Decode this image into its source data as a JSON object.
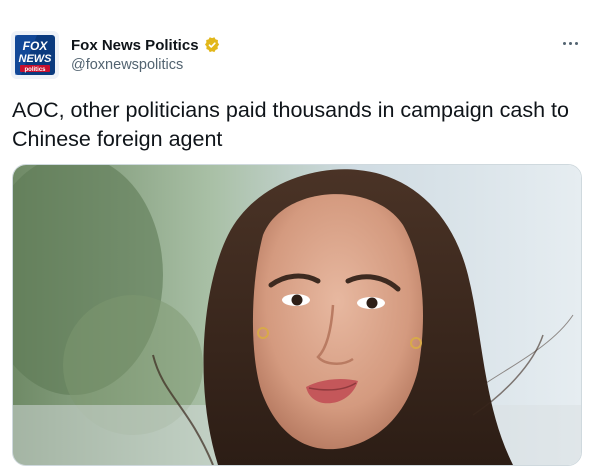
{
  "account": {
    "display_name": "Fox News Politics",
    "handle": "@foxnewspolitics",
    "logo": {
      "line1": "FOX",
      "line2": "NEWS",
      "line3": "politics"
    },
    "verified_icon": "verified-badge-gold"
  },
  "tweet": {
    "text": "AOC, other politicians paid thousands in campaign cash to Chinese foreign agent"
  },
  "menu_icon": "more-horizontal-icon",
  "colors": {
    "verified_gold": "#e2b719",
    "logo_blue": "#0a3a7e",
    "logo_red": "#c8102e",
    "handle_gray": "#536471"
  }
}
